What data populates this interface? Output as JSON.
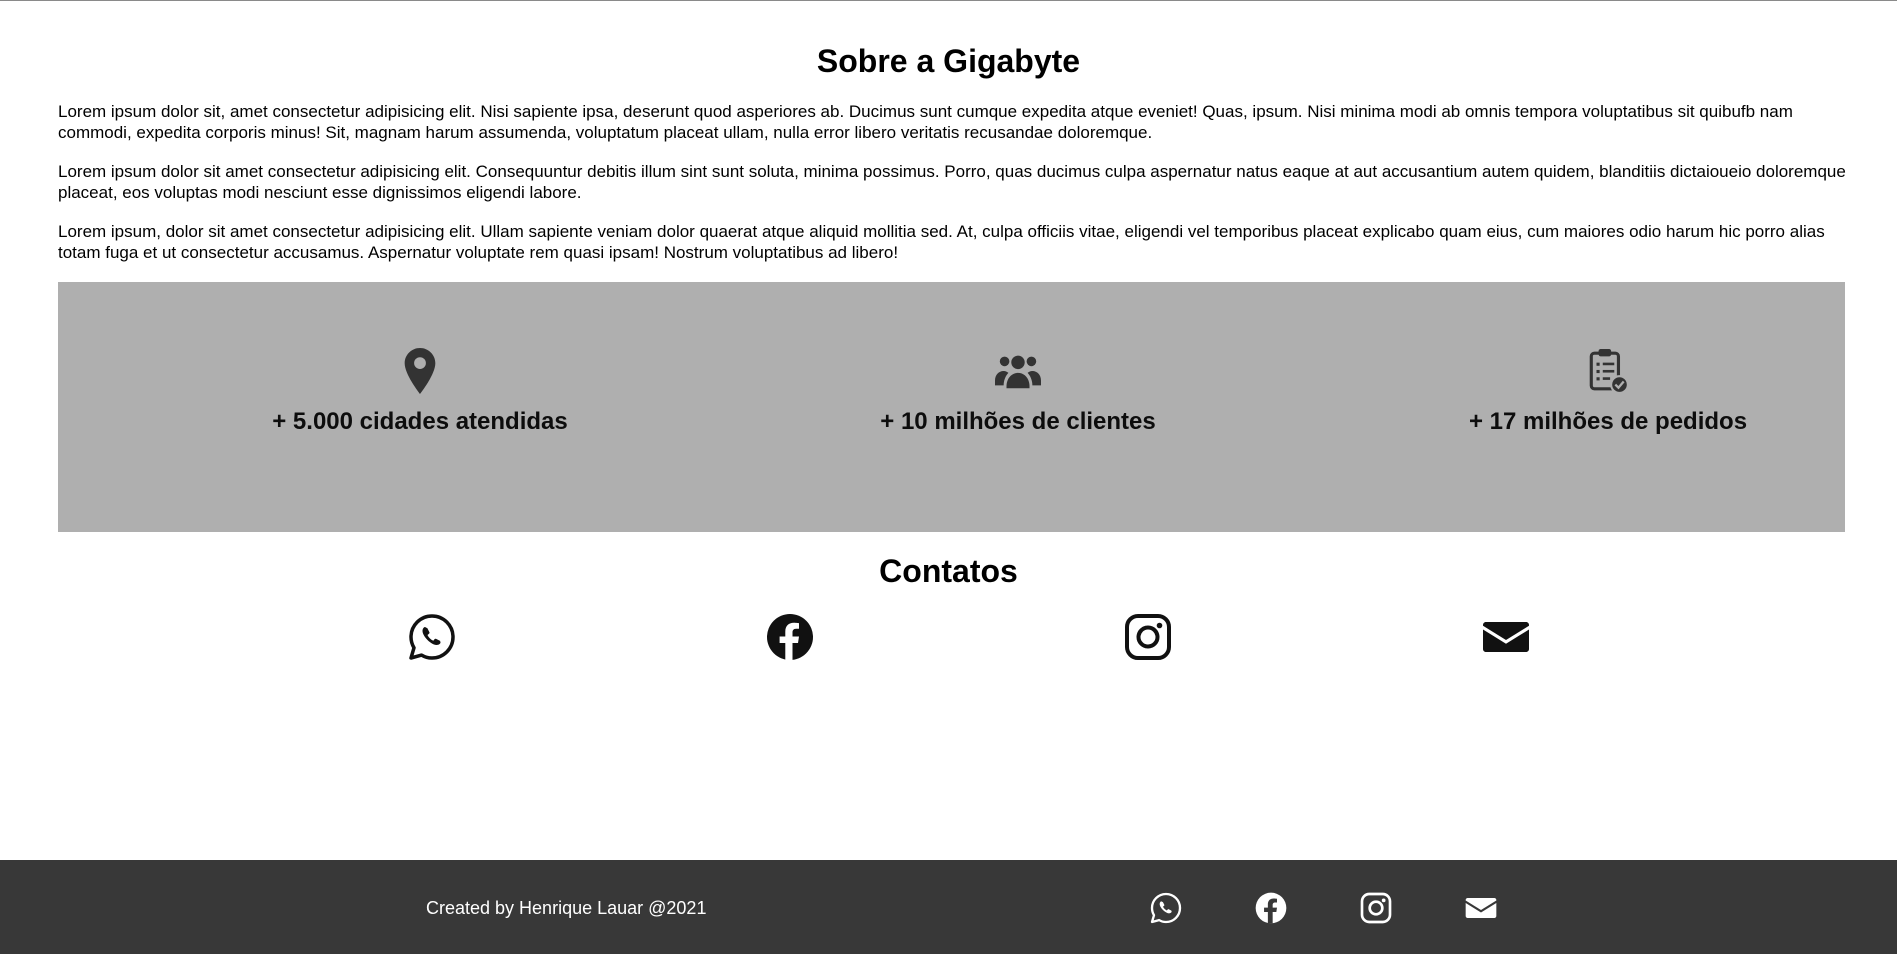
{
  "about": {
    "title": "Sobre a Gigabyte",
    "paragraphs": [
      "Lorem ipsum dolor sit, amet consectetur adipisicing elit. Nisi sapiente ipsa, deserunt quod asperiores ab. Ducimus sunt cumque expedita atque eveniet! Quas, ipsum. Nisi minima modi ab omnis tempora voluptatibus sit quibufb nam commodi, expedita corporis minus! Sit, magnam harum assumenda, voluptatum placeat ullam, nulla error libero veritatis recusandae doloremque.",
      "Lorem ipsum dolor sit amet consectetur adipisicing elit. Consequuntur debitis illum sint sunt soluta, minima possimus. Porro, quas ducimus culpa aspernatur natus eaque at aut accusantium autem quidem, blanditiis dictaioueio doloremque placeat, eos voluptas modi nesciunt esse dignissimos eligendi labore.",
      "Lorem ipsum, dolor sit amet consectetur adipisicing elit. Ullam sapiente veniam dolor quaerat atque aliquid mollitia sed. At, culpa officiis vitae, eligendi vel temporibus placeat explicabo quam eius, cum maiores odio harum hic porro alias totam fuga et ut consectetur accusamus. Aspernatur voluptate rem quasi ipsam! Nostrum voluptatibus ad libero!"
    ]
  },
  "stats": [
    {
      "icon": "map-marker-icon",
      "label": "+ 5.000 cidades atendidas"
    },
    {
      "icon": "users-icon",
      "label": "+ 10 milhões de clientes"
    },
    {
      "icon": "clipboard-check-icon",
      "label": "+ 17 milhões de pedidos"
    }
  ],
  "contacts": {
    "title": "Contatos",
    "items": [
      {
        "icon": "whatsapp-icon"
      },
      {
        "icon": "facebook-icon"
      },
      {
        "icon": "instagram-icon"
      },
      {
        "icon": "envelope-icon"
      }
    ]
  },
  "footer": {
    "credit": "Created by Henrique Lauar @2021",
    "links": [
      {
        "icon": "whatsapp-icon"
      },
      {
        "icon": "facebook-icon"
      },
      {
        "icon": "instagram-icon"
      },
      {
        "icon": "envelope-icon"
      }
    ]
  },
  "colors": {
    "stats_background": "#afafaf",
    "footer_background": "#383838",
    "icon_dark": "#333333",
    "contact_icon": "#111111",
    "footer_text": "#ffffff"
  }
}
